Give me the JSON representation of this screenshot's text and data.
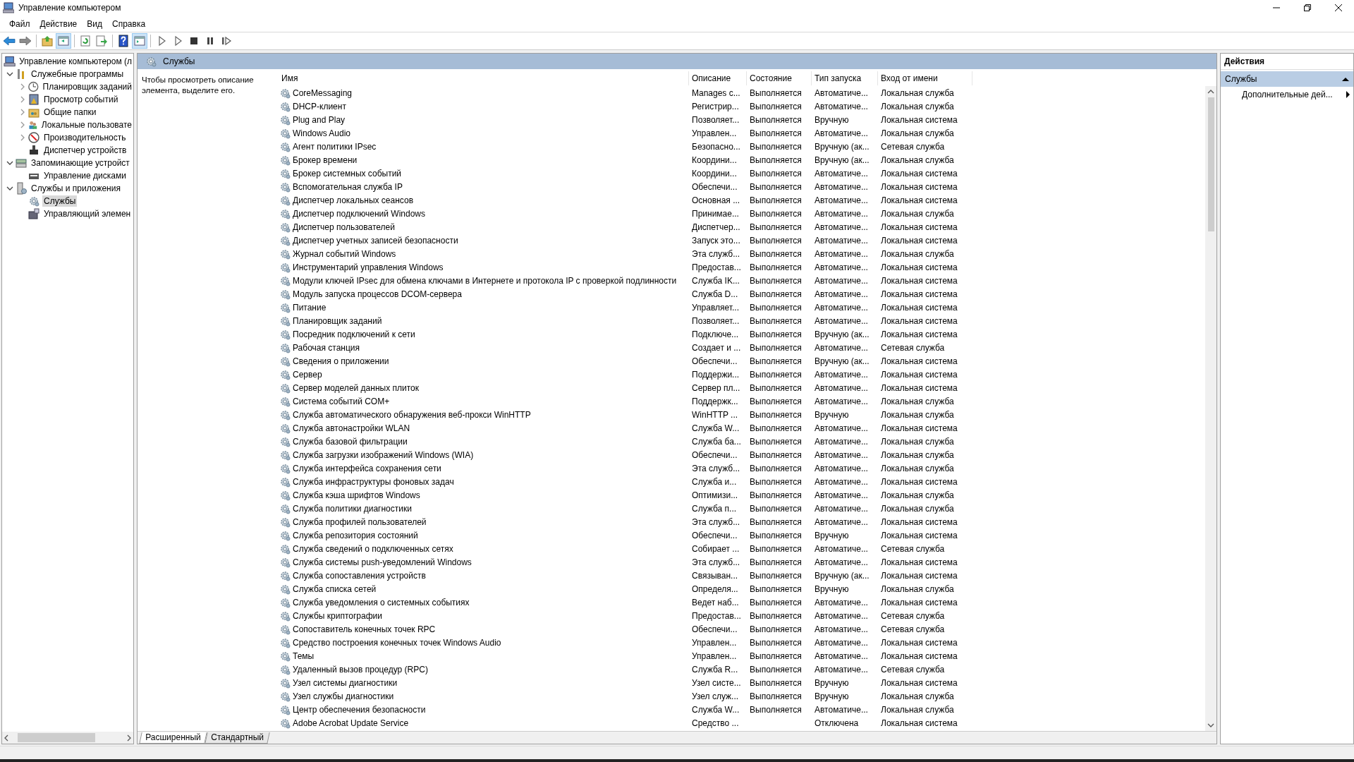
{
  "window": {
    "title": "Управление компьютером"
  },
  "menu": [
    "Файл",
    "Действие",
    "Вид",
    "Справка"
  ],
  "toolbar": [
    {
      "kind": "back",
      "pressed": false
    },
    {
      "kind": "forward",
      "pressed": false
    },
    {
      "kind": "sep"
    },
    {
      "kind": "up",
      "pressed": false
    },
    {
      "kind": "tree",
      "pressed": true
    },
    {
      "kind": "sep"
    },
    {
      "kind": "refresh",
      "pressed": false
    },
    {
      "kind": "export",
      "pressed": false
    },
    {
      "kind": "sep"
    },
    {
      "kind": "help",
      "pressed": false
    },
    {
      "kind": "pane",
      "pressed": true
    },
    {
      "kind": "sep"
    },
    {
      "kind": "play",
      "pressed": false
    },
    {
      "kind": "play",
      "pressed": false
    },
    {
      "kind": "stop",
      "pressed": false
    },
    {
      "kind": "pause",
      "pressed": false
    },
    {
      "kind": "resume",
      "pressed": false
    }
  ],
  "tree": [
    {
      "label": "Управление компьютером (л",
      "selected": false,
      "children": [
        {
          "label": "Служебные программы",
          "expanded": true,
          "selected": false,
          "children": [
            {
              "label": "Планировщик заданий",
              "expanded": false,
              "selected": false
            },
            {
              "label": "Просмотр событий",
              "expanded": false,
              "selected": false
            },
            {
              "label": "Общие папки",
              "expanded": false,
              "selected": false
            },
            {
              "label": "Локальные пользовате",
              "expanded": false,
              "selected": false
            },
            {
              "label": "Производительность",
              "expanded": false,
              "selected": false
            },
            {
              "label": "Диспетчер устройств",
              "selected": false
            }
          ]
        },
        {
          "label": "Запоминающие устройст",
          "expanded": true,
          "selected": false,
          "children": [
            {
              "label": "Управление дисками",
              "selected": false
            }
          ]
        },
        {
          "label": "Службы и приложения",
          "expanded": true,
          "selected": false,
          "children": [
            {
              "label": "Службы",
              "selected": true
            },
            {
              "label": "Управляющий элемен",
              "selected": false
            }
          ]
        }
      ]
    }
  ],
  "content": {
    "title": "Службы",
    "hint": "Чтобы просмотреть описание элемента, выделите его.",
    "columns": [
      "Имя",
      "Описание",
      "Состояние",
      "Тип запуска",
      "Вход от имени"
    ],
    "rows": [
      [
        "CoreMessaging",
        "Manages c...",
        "Выполняется",
        "Автоматиче...",
        "Локальная служба"
      ],
      [
        "DHCP-клиент",
        "Регистрир...",
        "Выполняется",
        "Автоматиче...",
        "Локальная служба"
      ],
      [
        "Plug and Play",
        "Позволяет...",
        "Выполняется",
        "Вручную",
        "Локальная система"
      ],
      [
        "Windows Audio",
        "Управлен...",
        "Выполняется",
        "Автоматиче...",
        "Локальная служба"
      ],
      [
        "Агент политики IPsec",
        "Безопасно...",
        "Выполняется",
        "Вручную (ак...",
        "Сетевая служба"
      ],
      [
        "Брокер времени",
        "Координи...",
        "Выполняется",
        "Вручную (ак...",
        "Локальная служба"
      ],
      [
        "Брокер системных событий",
        "Координи...",
        "Выполняется",
        "Автоматиче...",
        "Локальная система"
      ],
      [
        "Вспомогательная служба IP",
        "Обеспечи...",
        "Выполняется",
        "Автоматиче...",
        "Локальная система"
      ],
      [
        "Диспетчер локальных сеансов",
        "Основная ...",
        "Выполняется",
        "Автоматиче...",
        "Локальная система"
      ],
      [
        "Диспетчер подключений Windows",
        "Принимае...",
        "Выполняется",
        "Автоматиче...",
        "Локальная служба"
      ],
      [
        "Диспетчер пользователей",
        "Диспетчер...",
        "Выполняется",
        "Автоматиче...",
        "Локальная система"
      ],
      [
        "Диспетчер учетных записей безопасности",
        "Запуск это...",
        "Выполняется",
        "Автоматиче...",
        "Локальная система"
      ],
      [
        "Журнал событий Windows",
        "Эта служб...",
        "Выполняется",
        "Автоматиче...",
        "Локальная служба"
      ],
      [
        "Инструментарий управления Windows",
        "Предостав...",
        "Выполняется",
        "Автоматиче...",
        "Локальная система"
      ],
      [
        "Модули ключей IPsec для обмена ключами в Интернете и протокола IP с проверкой подлинности",
        "Служба IK...",
        "Выполняется",
        "Автоматиче...",
        "Локальная система"
      ],
      [
        "Модуль запуска процессов DCOM-сервера",
        "Служба D...",
        "Выполняется",
        "Автоматиче...",
        "Локальная система"
      ],
      [
        "Питание",
        "Управляет...",
        "Выполняется",
        "Автоматиче...",
        "Локальная система"
      ],
      [
        "Планировщик заданий",
        "Позволяет...",
        "Выполняется",
        "Автоматиче...",
        "Локальная система"
      ],
      [
        "Посредник подключений к сети",
        "Подключе...",
        "Выполняется",
        "Вручную (ак...",
        "Локальная система"
      ],
      [
        "Рабочая станция",
        "Создает и ...",
        "Выполняется",
        "Автоматиче...",
        "Сетевая служба"
      ],
      [
        "Сведения о приложении",
        "Обеспечи...",
        "Выполняется",
        "Вручную (ак...",
        "Локальная система"
      ],
      [
        "Сервер",
        "Поддержи...",
        "Выполняется",
        "Автоматиче...",
        "Локальная система"
      ],
      [
        "Сервер моделей данных плиток",
        "Сервер пл...",
        "Выполняется",
        "Автоматиче...",
        "Локальная система"
      ],
      [
        "Система событий COM+",
        "Поддержк...",
        "Выполняется",
        "Автоматиче...",
        "Локальная служба"
      ],
      [
        "Служба автоматического обнаружения веб-прокси WinHTTP",
        "WinHTTP ...",
        "Выполняется",
        "Вручную",
        "Локальная служба"
      ],
      [
        "Служба автонастройки WLAN",
        "Служба W...",
        "Выполняется",
        "Автоматиче...",
        "Локальная система"
      ],
      [
        "Служба базовой фильтрации",
        "Служба ба...",
        "Выполняется",
        "Автоматиче...",
        "Локальная служба"
      ],
      [
        "Служба загрузки изображений Windows (WIA)",
        "Обеспечи...",
        "Выполняется",
        "Автоматиче...",
        "Локальная служба"
      ],
      [
        "Служба интерфейса сохранения сети",
        "Эта служб...",
        "Выполняется",
        "Автоматиче...",
        "Локальная служба"
      ],
      [
        "Служба инфраструктуры фоновых задач",
        "Служба и...",
        "Выполняется",
        "Автоматиче...",
        "Локальная система"
      ],
      [
        "Служба кэша шрифтов Windows",
        "Оптимизи...",
        "Выполняется",
        "Автоматиче...",
        "Локальная служба"
      ],
      [
        "Служба политики диагностики",
        "Служба п...",
        "Выполняется",
        "Автоматиче...",
        "Локальная служба"
      ],
      [
        "Служба профилей пользователей",
        "Эта служб...",
        "Выполняется",
        "Автоматиче...",
        "Локальная система"
      ],
      [
        "Служба репозитория состояний",
        "Обеспечи...",
        "Выполняется",
        "Вручную",
        "Локальная система"
      ],
      [
        "Служба сведений о подключенных сетях",
        "Собирает ...",
        "Выполняется",
        "Автоматиче...",
        "Сетевая служба"
      ],
      [
        "Служба системы push-уведомлений Windows",
        "Эта служб...",
        "Выполняется",
        "Автоматиче...",
        "Локальная система"
      ],
      [
        "Служба сопоставления устройств",
        "Связыван...",
        "Выполняется",
        "Вручную (ак...",
        "Локальная система"
      ],
      [
        "Служба списка сетей",
        "Определя...",
        "Выполняется",
        "Вручную",
        "Локальная служба"
      ],
      [
        "Служба уведомления о системных событиях",
        "Ведет наб...",
        "Выполняется",
        "Автоматиче...",
        "Локальная система"
      ],
      [
        "Службы криптографии",
        "Предостав...",
        "Выполняется",
        "Автоматиче...",
        "Сетевая служба"
      ],
      [
        "Сопоставитель конечных точек RPC",
        "Обеспечи...",
        "Выполняется",
        "Автоматиче...",
        "Сетевая служба"
      ],
      [
        "Средство построения конечных точек Windows Audio",
        "Управлен...",
        "Выполняется",
        "Автоматиче...",
        "Локальная система"
      ],
      [
        "Темы",
        "Управлен...",
        "Выполняется",
        "Автоматиче...",
        "Локальная система"
      ],
      [
        "Удаленный вызов процедур (RPC)",
        "Служба R...",
        "Выполняется",
        "Автоматиче...",
        "Сетевая служба"
      ],
      [
        "Узел системы диагностики",
        "Узел систе...",
        "Выполняется",
        "Вручную",
        "Локальная система"
      ],
      [
        "Узел службы диагностики",
        "Узел служ...",
        "Выполняется",
        "Вручную",
        "Локальная служба"
      ],
      [
        "Центр обеспечения безопасности",
        "Служба W...",
        "Выполняется",
        "Автоматиче...",
        "Локальная служба"
      ],
      [
        "Adobe Acrobat Update Service",
        "Средство ...",
        "",
        "Отключена",
        "Локальная система"
      ]
    ],
    "tabs": [
      {
        "label": "Расширенный",
        "selected": true
      },
      {
        "label": "Стандартный",
        "selected": false
      }
    ]
  },
  "actions": {
    "title": "Действия",
    "section": "Службы",
    "section_expanded": true,
    "items": [
      "Дополнительные дей..."
    ]
  }
}
